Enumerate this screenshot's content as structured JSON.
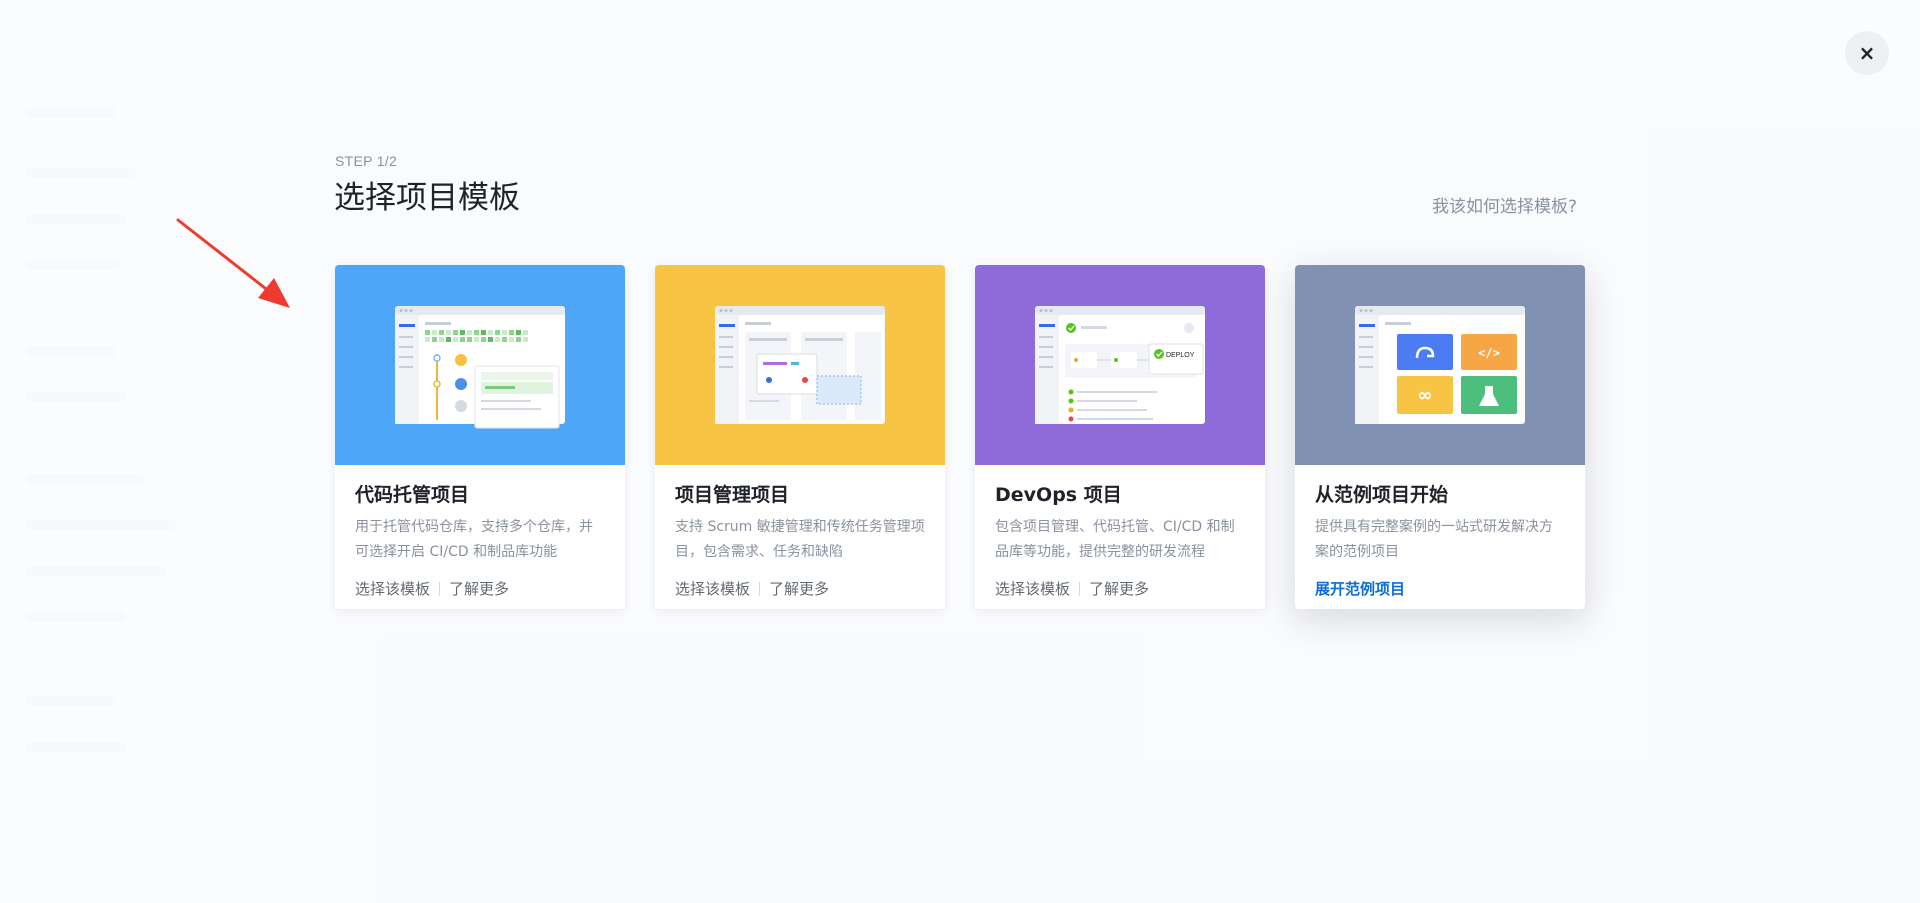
{
  "header": {
    "step": "STEP 1/2",
    "title": "选择项目模板",
    "help_link": "我该如何选择模板?"
  },
  "close_label": "×",
  "cards": [
    {
      "id": "code-hosting",
      "title": "代码托管项目",
      "description": "用于托管代码仓库，支持多个仓库，并可选择开启 CI/CD 和制品库功能",
      "actions": [
        "选择该模板",
        "了解更多"
      ],
      "color": "#4da6f7"
    },
    {
      "id": "project-management",
      "title": "项目管理项目",
      "description": "支持 Scrum 敏捷管理和传统任务管理项目，包含需求、任务和缺陷",
      "actions": [
        "选择该模板",
        "了解更多"
      ],
      "color": "#f8c444"
    },
    {
      "id": "devops",
      "title": "DevOps 项目",
      "description": "包含项目管理、代码托管、CI/CD 和制品库等功能，提供完整的研发流程",
      "actions": [
        "选择该模板",
        "了解更多"
      ],
      "color": "#8f6bd9",
      "badge": "DEPLOY"
    },
    {
      "id": "example",
      "title": "从范例项目开始",
      "description": "提供具有完整案例的一站式研发解决方案的范例项目",
      "actions": [
        "展开范例项目"
      ],
      "color": "#8091b3"
    }
  ],
  "colors": {
    "accent_link": "#0a6dd9",
    "arrow": "#ef3b2d"
  }
}
